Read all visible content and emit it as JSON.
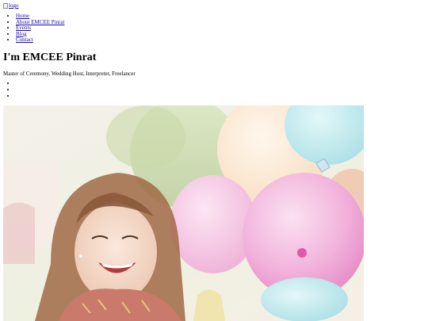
{
  "logo": {
    "alt": "logo"
  },
  "nav": {
    "items": [
      {
        "label": "Home"
      },
      {
        "label": "About EMCEE Pinrat"
      },
      {
        "label": "Events"
      },
      {
        "label": "Blog"
      },
      {
        "label": "Contact"
      }
    ]
  },
  "hero_heading": "I'm EMCEE Pinrat",
  "tagline": "Master of Ceremony, Wedding Host, Interpreter, Freelancer",
  "slider": {
    "dot_count": 3
  },
  "colors": {
    "link": "#1a0dab",
    "balloon_pink": "#f2a6d8",
    "balloon_blue": "#bfe9ee",
    "balloon_peach": "#fbe2c8"
  }
}
